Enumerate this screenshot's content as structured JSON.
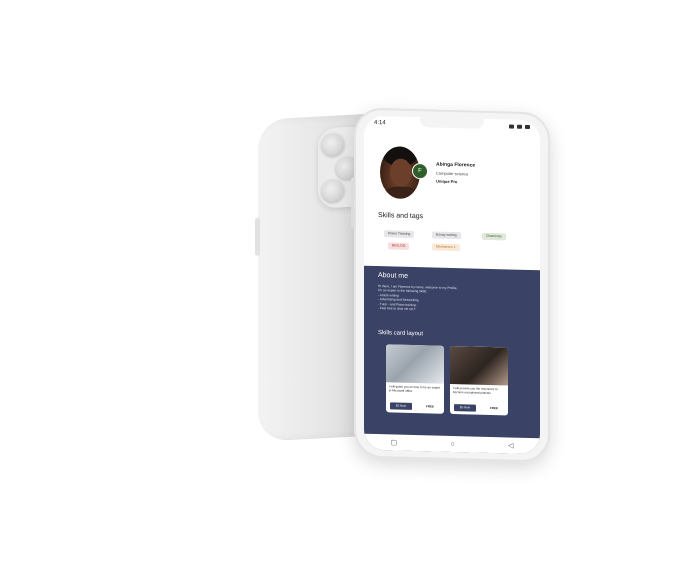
{
  "status_bar": {
    "time": "4:14"
  },
  "profile": {
    "badge_initial": "F",
    "name": "Abinga Florence",
    "role": "Computer science",
    "plan": "Unique Pro"
  },
  "skills": {
    "title": "Skills and tags",
    "tags": [
      {
        "label": "Piano Training",
        "bg": "#e6e6ea",
        "color": "#444444"
      },
      {
        "label": "Essay writing",
        "bg": "#e6e6ea",
        "color": "#444444"
      },
      {
        "label": "Chemistry",
        "bg": "#dfe8da",
        "color": "#2f5e2a"
      },
      {
        "label": "BIOLOG",
        "bg": "#f6dede",
        "color": "#b03030"
      },
      {
        "label": "Mechanics 1",
        "bg": "#f8ead8",
        "color": "#c07020"
      }
    ]
  },
  "about": {
    "title": "About me",
    "lines": [
      "Hi there, I am Florence by name, welcome to my Profile,",
      "I'm an expert in the following skills;",
      "- Article writing",
      "- Advertising and Networking",
      "- Tutor - and Piano training.",
      "- Feel free to chat me up !!"
    ]
  },
  "skills_cards": {
    "title": "Skills card layout",
    "cards": [
      {
        "text": "I will guide you on how to be an expert in Microsoft office",
        "button": "$5 Now",
        "price": "FREE"
      },
      {
        "text": "I will provide you the resources to become exceptional pianists",
        "button": "$5 Now",
        "price": "FREE"
      }
    ]
  },
  "navbar": {
    "back_icon": "◁",
    "home_icon": "○",
    "recent_icon": "▢"
  }
}
